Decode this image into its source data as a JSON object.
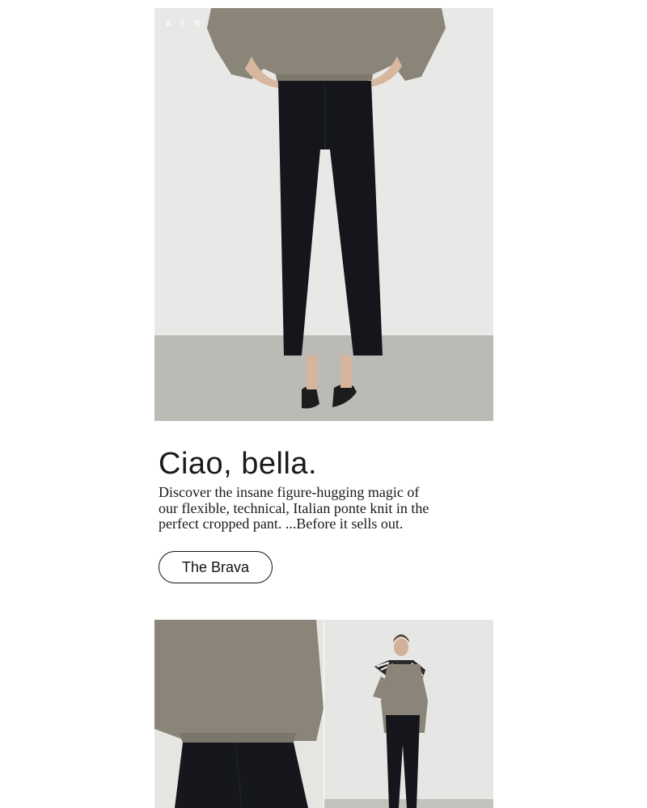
{
  "brand": {
    "logo_text": "AYR"
  },
  "hero": {
    "image": "model-in-black-cropped-pants-photo"
  },
  "copy": {
    "headline": "Ciao, bella.",
    "body": "Discover the insane figure-hugging magic of our flexible, technical, Italian ponte knit in the perfect cropped pant. ...Before it sells out."
  },
  "cta": {
    "label": "The Brava"
  },
  "gallery": [
    {
      "image": "back-view-olive-shirt-photo"
    },
    {
      "image": "full-length-model-with-scarf-photo"
    }
  ],
  "colors": {
    "shirt": "#8a8578",
    "pants": "#14161c",
    "background": "#e7e7e5",
    "floor": "#b9b7b2"
  }
}
